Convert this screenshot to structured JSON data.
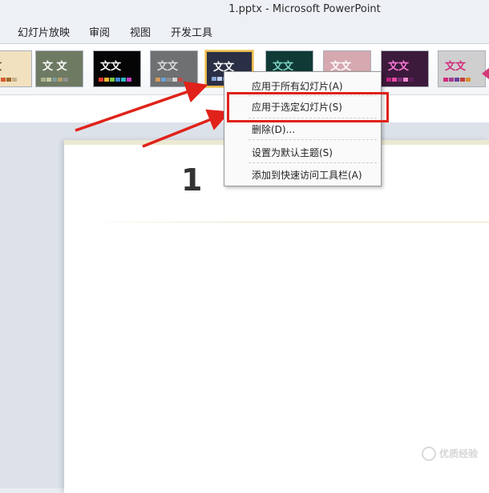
{
  "window": {
    "title": "1.pptx  -  Microsoft PowerPoint"
  },
  "ribbon_tabs": [
    "幻灯片放映",
    "审阅",
    "视图",
    "开发工具"
  ],
  "themes": [
    {
      "text": "文",
      "bg": "#f1e1bf",
      "fg": "#4a3d20",
      "colors": [
        "#c9a55f",
        "#e0b040",
        "#d65a2d",
        "#9a6a2a",
        "#c8b28a"
      ]
    },
    {
      "text": "文 文",
      "bg": "#6f7a63",
      "fg": "#ffffff",
      "colors": [
        "#a9b48f",
        "#c7c9a2",
        "#7d9b9b",
        "#b59e6b",
        "#8f8f8f"
      ]
    },
    {
      "text": "文文",
      "bg": "#050505",
      "fg": "#ffffff",
      "colors": [
        "#e43b2c",
        "#f2b632",
        "#7cc545",
        "#3d8ad9",
        "#2fb8c7",
        "#c23ec0"
      ]
    },
    {
      "text": "文文",
      "bg": "#6f7072",
      "fg": "#dcdcdc",
      "colors": [
        "#d49b5a",
        "#6aa1d6",
        "#8f8f8f",
        "#d5d5d5",
        "#c04a4a"
      ]
    },
    {
      "text": "文文",
      "bg": "#2b2f45",
      "fg": "#ffffff",
      "colors": [
        "#8ba5d8",
        "#c3d1ea",
        "#6f86b7",
        "#ffffff",
        "#a6a6a6"
      ]
    },
    {
      "text": "文文",
      "bg": "#103a36",
      "fg": "#7fd4c6",
      "colors": [
        "#29a892",
        "#3ec7a7",
        "#1f7f6e",
        "#9ee0d0",
        "#6cbfad"
      ]
    },
    {
      "text": "文文",
      "bg": "#d6a8b0",
      "fg": "#ffffff",
      "colors": [
        "#b25a72",
        "#d98c9c",
        "#a76b7c",
        "#e7c6cc",
        "#8e4b5b"
      ]
    },
    {
      "text": "文文",
      "bg": "#3c1a3b",
      "fg": "#ff7ad9",
      "colors": [
        "#c0237f",
        "#e84aa2",
        "#7b2f7a",
        "#f08cd0",
        "#5b1f5a"
      ]
    },
    {
      "text": "文文",
      "bg": "#cfcfcf",
      "fg": "#d12b7a",
      "colors": [
        "#d12b7a",
        "#a33a8f",
        "#6a3d9a",
        "#c53d3d",
        "#d98c2f"
      ]
    }
  ],
  "context_menu": {
    "items": [
      "应用于所有幻灯片(A)",
      "应用于选定幻灯片(S)",
      "删除(D)...",
      "设置为默认主题(S)",
      "添加到快速访问工具栏(A)"
    ]
  },
  "slide": {
    "number": "1"
  },
  "watermark": {
    "text": "优质经验"
  }
}
